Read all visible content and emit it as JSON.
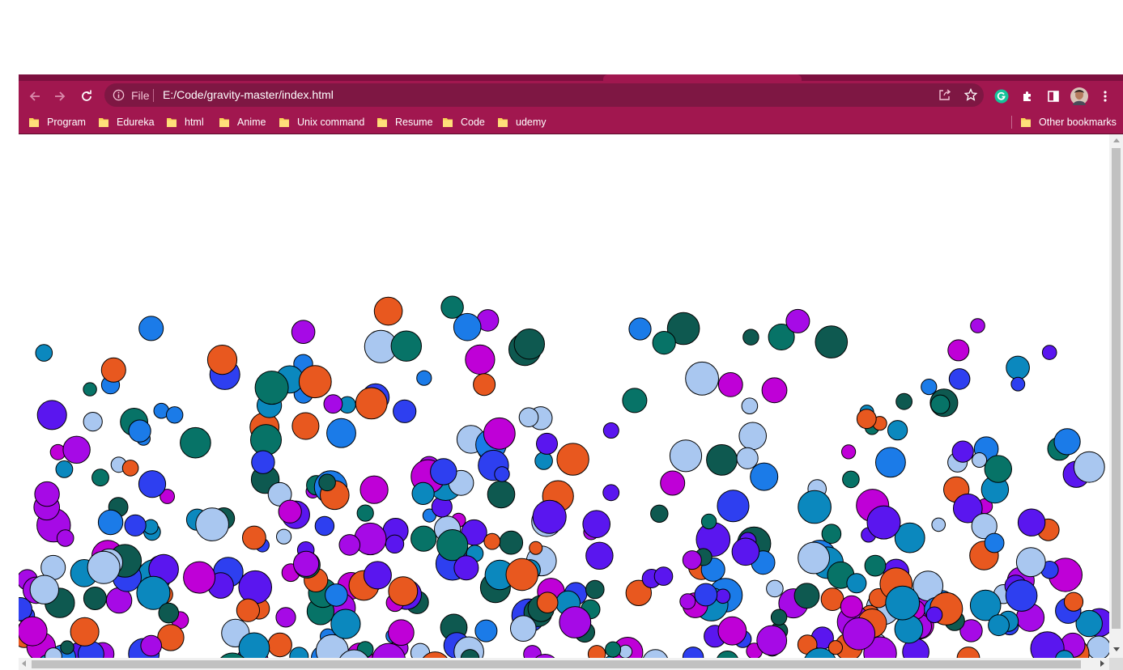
{
  "browser": {
    "theme_color": "#a1174f",
    "omnibox": {
      "scheme_label": "File",
      "url": "E:/Code/gravity-master/index.html"
    },
    "toolbar_icons": [
      "back-icon",
      "forward-icon",
      "reload-icon",
      "info-icon",
      "share-icon",
      "star-icon",
      "grammarly-icon",
      "extensions-icon",
      "side-panel-icon",
      "profile-avatar",
      "menu-icon"
    ],
    "bookmarks": [
      {
        "label": "Program"
      },
      {
        "label": "Edureka"
      },
      {
        "label": "html"
      },
      {
        "label": "Anime"
      },
      {
        "label": "Unix command"
      },
      {
        "label": "Resume"
      },
      {
        "label": "Code"
      },
      {
        "label": "udemy"
      }
    ],
    "other_bookmarks": "Other bookmarks"
  },
  "page": {
    "description_palette": [
      "#e8581f",
      "#1b7be8",
      "#2e3ff0",
      "#a60ae6",
      "#5a16ef",
      "#077367",
      "#0e5950",
      "#0b88be",
      "#a9c7f0",
      "#bf00d7"
    ],
    "ball_count": 400
  }
}
